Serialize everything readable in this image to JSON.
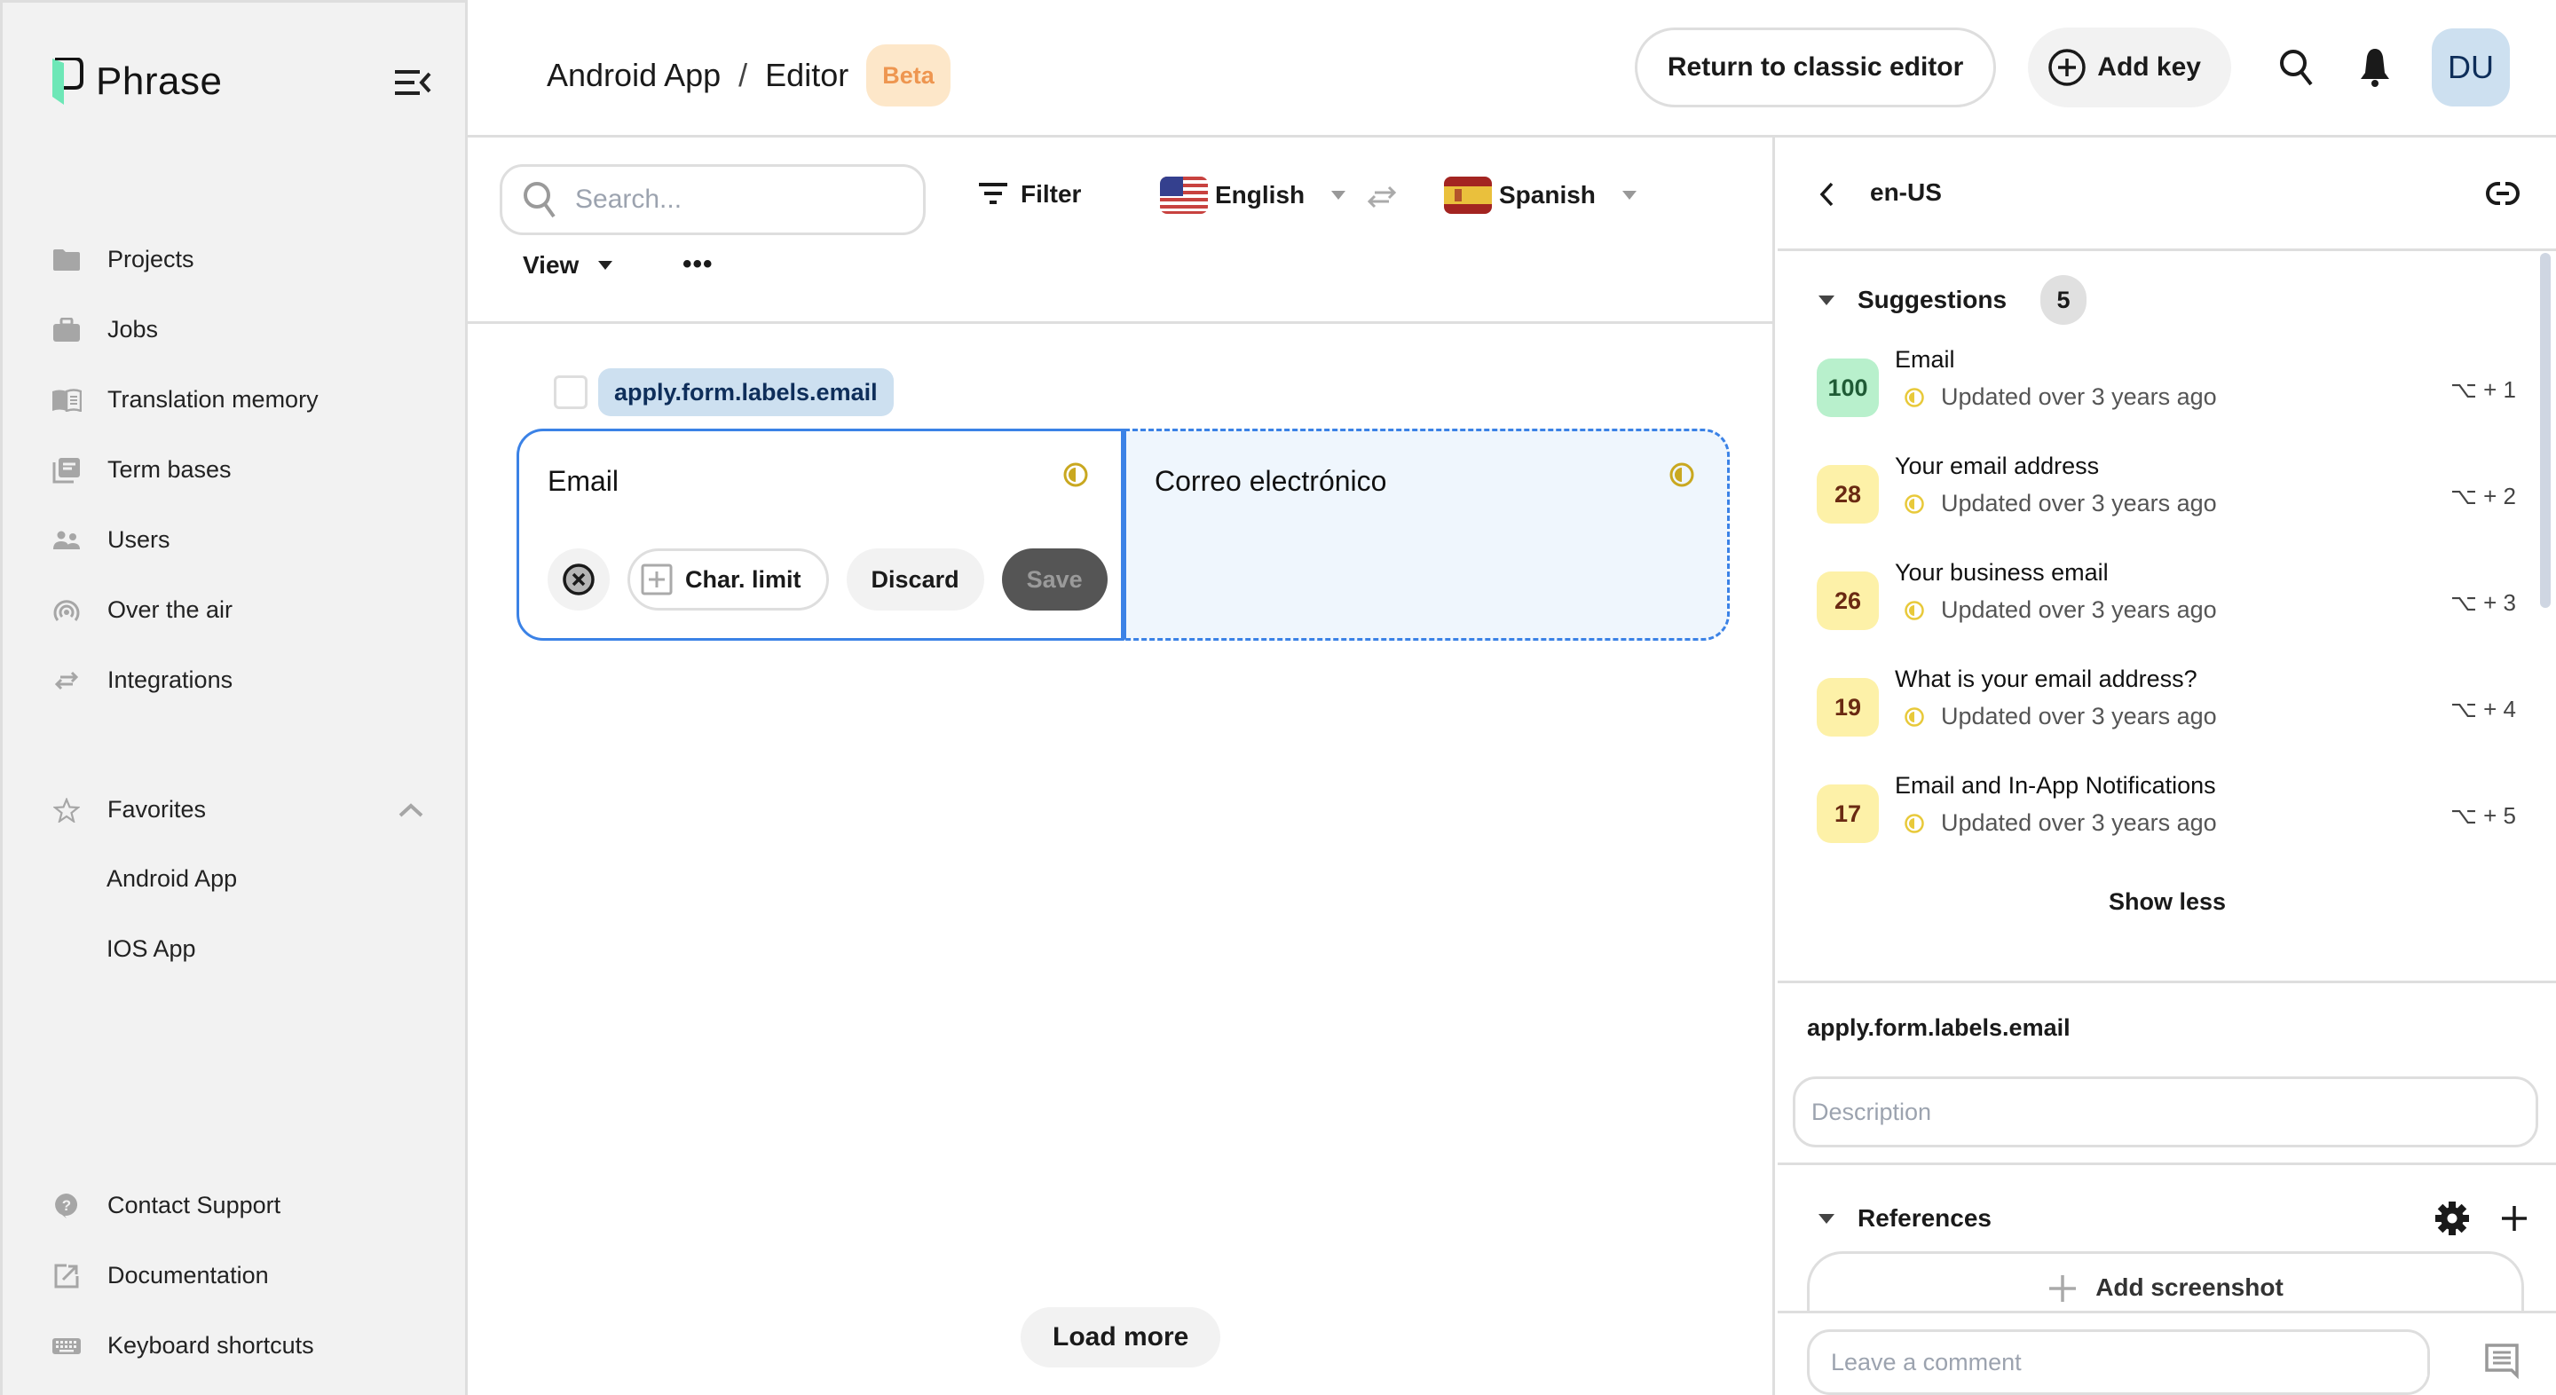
{
  "app": {
    "brand": "Phrase",
    "colors": {
      "accent_blue": "#3b82e6",
      "brand_green": "#6ee7b7",
      "beta_bg": "#fde7c9",
      "beta_text": "#ee9650",
      "key_chip_bg": "#cde0f0",
      "score_high_bg": "#b8f0cc",
      "score_low_bg": "#fdf1a8",
      "status_icon": "#c9a820"
    }
  },
  "sidebar": {
    "collapse_icon": "menu-collapse-icon",
    "items": [
      {
        "label": "Projects",
        "icon": "folder-icon"
      },
      {
        "label": "Jobs",
        "icon": "briefcase-icon"
      },
      {
        "label": "Translation memory",
        "icon": "book-icon"
      },
      {
        "label": "Term bases",
        "icon": "library-icon"
      },
      {
        "label": "Users",
        "icon": "users-icon"
      },
      {
        "label": "Over the air",
        "icon": "broadcast-icon"
      },
      {
        "label": "Integrations",
        "icon": "swap-arrows-icon"
      }
    ],
    "favorites": {
      "label": "Favorites",
      "icon": "star-icon",
      "expanded": true,
      "items": [
        {
          "label": "Android App"
        },
        {
          "label": "IOS App"
        }
      ]
    },
    "bottom_items": [
      {
        "label": "Contact Support",
        "icon": "help-icon"
      },
      {
        "label": "Documentation",
        "icon": "external-link-icon"
      },
      {
        "label": "Keyboard shortcuts",
        "icon": "keyboard-icon"
      }
    ]
  },
  "header": {
    "breadcrumb": [
      "Android App",
      "Editor"
    ],
    "separator": "/",
    "badge": "Beta",
    "return_classic": "Return to classic editor",
    "add_key": "Add key",
    "avatar_initials": "DU"
  },
  "toolbar": {
    "search_placeholder": "Search...",
    "search_value": "",
    "filter_label": "Filter",
    "source_language": "English",
    "target_language": "Spanish",
    "view_label": "View",
    "more_label": "•••"
  },
  "editor": {
    "key_name": "apply.form.labels.email",
    "source_text": "Email",
    "target_text": "Correo electrónico",
    "actions": {
      "char_limit": "Char. limit",
      "discard": "Discard",
      "save": "Save"
    },
    "load_more": "Load more"
  },
  "panel": {
    "locale": "en-US",
    "suggestions_title": "Suggestions",
    "suggestions_count": "5",
    "suggestions": [
      {
        "score": "100",
        "text": "Email",
        "meta": "Updated over 3 years ago",
        "shortcut": "⌥ + 1",
        "level": "high"
      },
      {
        "score": "28",
        "text": "Your email address",
        "meta": "Updated over 3 years ago",
        "shortcut": "⌥ + 2",
        "level": "low"
      },
      {
        "score": "26",
        "text": "Your business email",
        "meta": "Updated over 3 years ago",
        "shortcut": "⌥ + 3",
        "level": "low"
      },
      {
        "score": "19",
        "text": "What is your email address?",
        "meta": "Updated over 3 years ago",
        "shortcut": "⌥ + 4",
        "level": "low"
      },
      {
        "score": "17",
        "text": "Email and In-App Notifications",
        "meta": "Updated over 3 years ago",
        "shortcut": "⌥ + 5",
        "level": "low"
      }
    ],
    "show_less": "Show less",
    "key_name": "apply.form.labels.email",
    "description_placeholder": "Description",
    "references_title": "References",
    "add_screenshot": "Add screenshot",
    "comment_placeholder": "Leave a comment"
  }
}
